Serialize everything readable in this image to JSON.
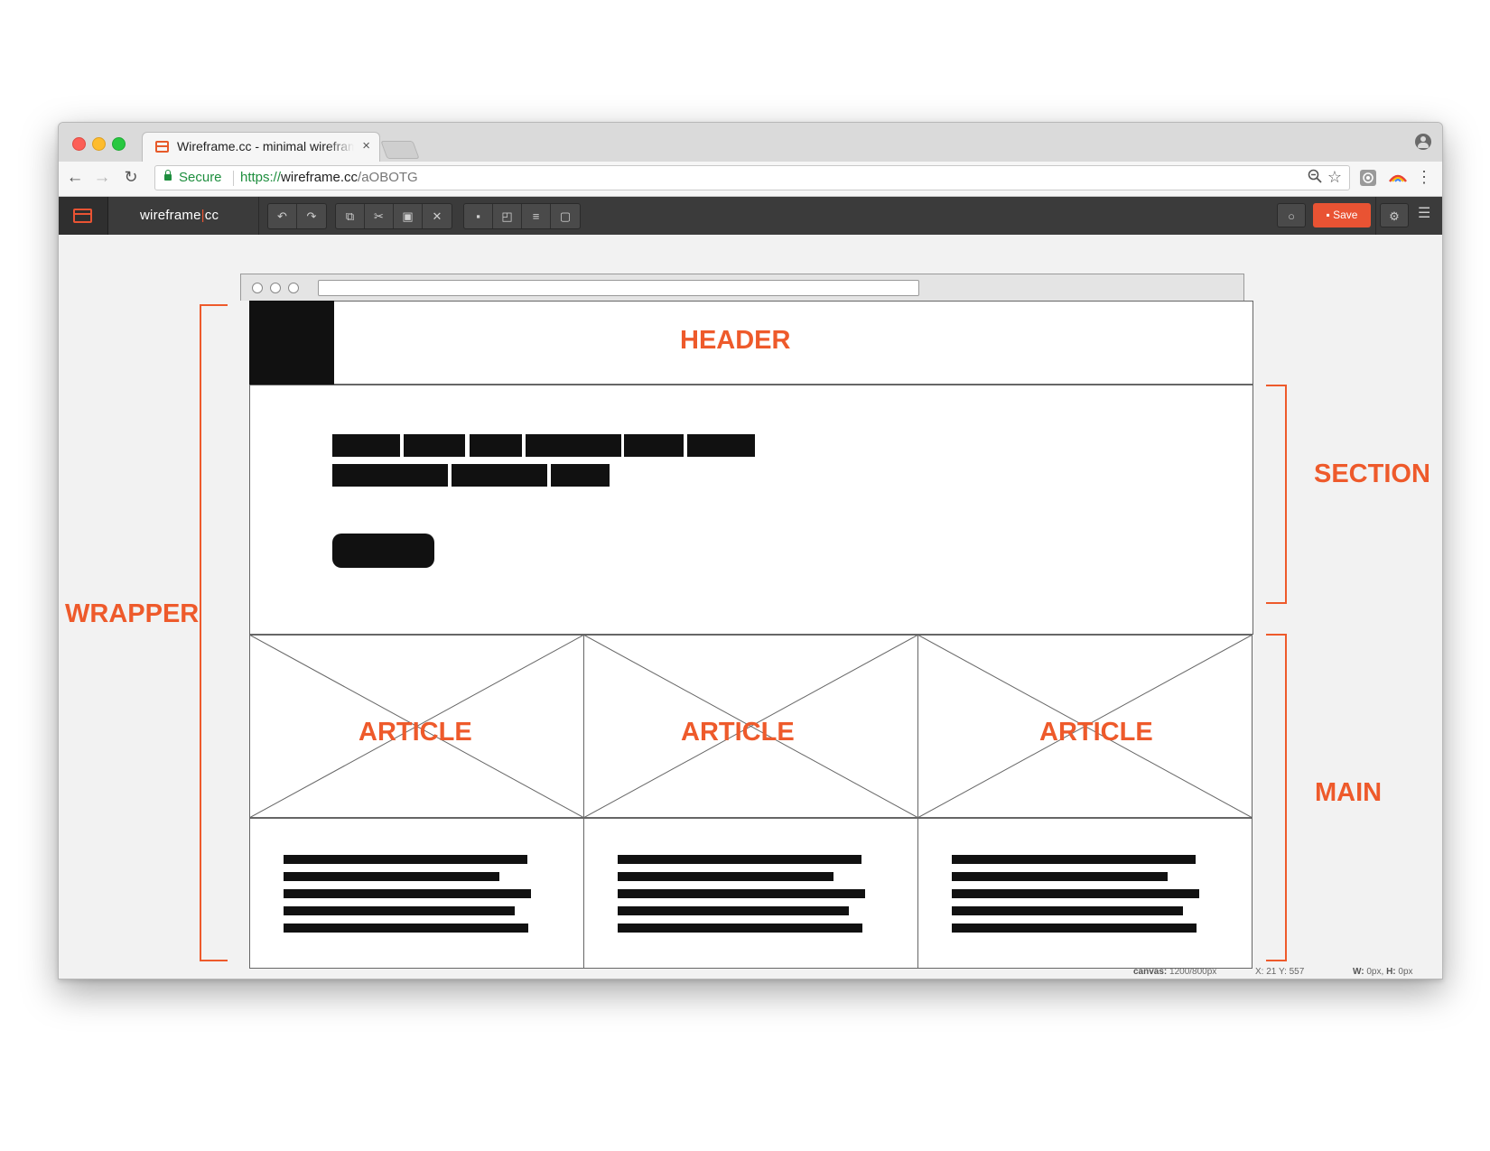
{
  "browser": {
    "tab_title": "Wireframe.cc - minimal wireframe",
    "tab_close": "×",
    "secure_label": "Secure",
    "url_scheme": "https://",
    "url_host": "wireframe.cc",
    "url_path": "/aOBOTG"
  },
  "app": {
    "name_left": "wireframe",
    "name_pipe": "|",
    "name_right": "cc",
    "save_label": "Save",
    "icons": [
      "undo-icon",
      "redo-icon",
      "copy-icon",
      "cut-icon",
      "paste-icon",
      "delete-icon",
      "lock-icon",
      "arrange-icon",
      "align-icon",
      "group-icon",
      "comment-icon",
      "settings-icon",
      "menu-icon"
    ]
  },
  "status": {
    "canvas_label": "canvas:",
    "canvas_value": "1200/800px",
    "xy": "X: 21 Y: 557",
    "wh_w_label": "W:",
    "wh_w_value": "0px,",
    "wh_h_label": "H:",
    "wh_h_value": "0px"
  },
  "annotations": {
    "header": "HEADER",
    "section": "SECTION",
    "wrapper": "WRAPPER",
    "main": "MAIN",
    "article": "ARTICLE"
  },
  "colors": {
    "accent": "#ee5a2b",
    "toolbar": "#3b3b3b",
    "save_button": "#e95333",
    "secure": "#1e8e3e"
  }
}
